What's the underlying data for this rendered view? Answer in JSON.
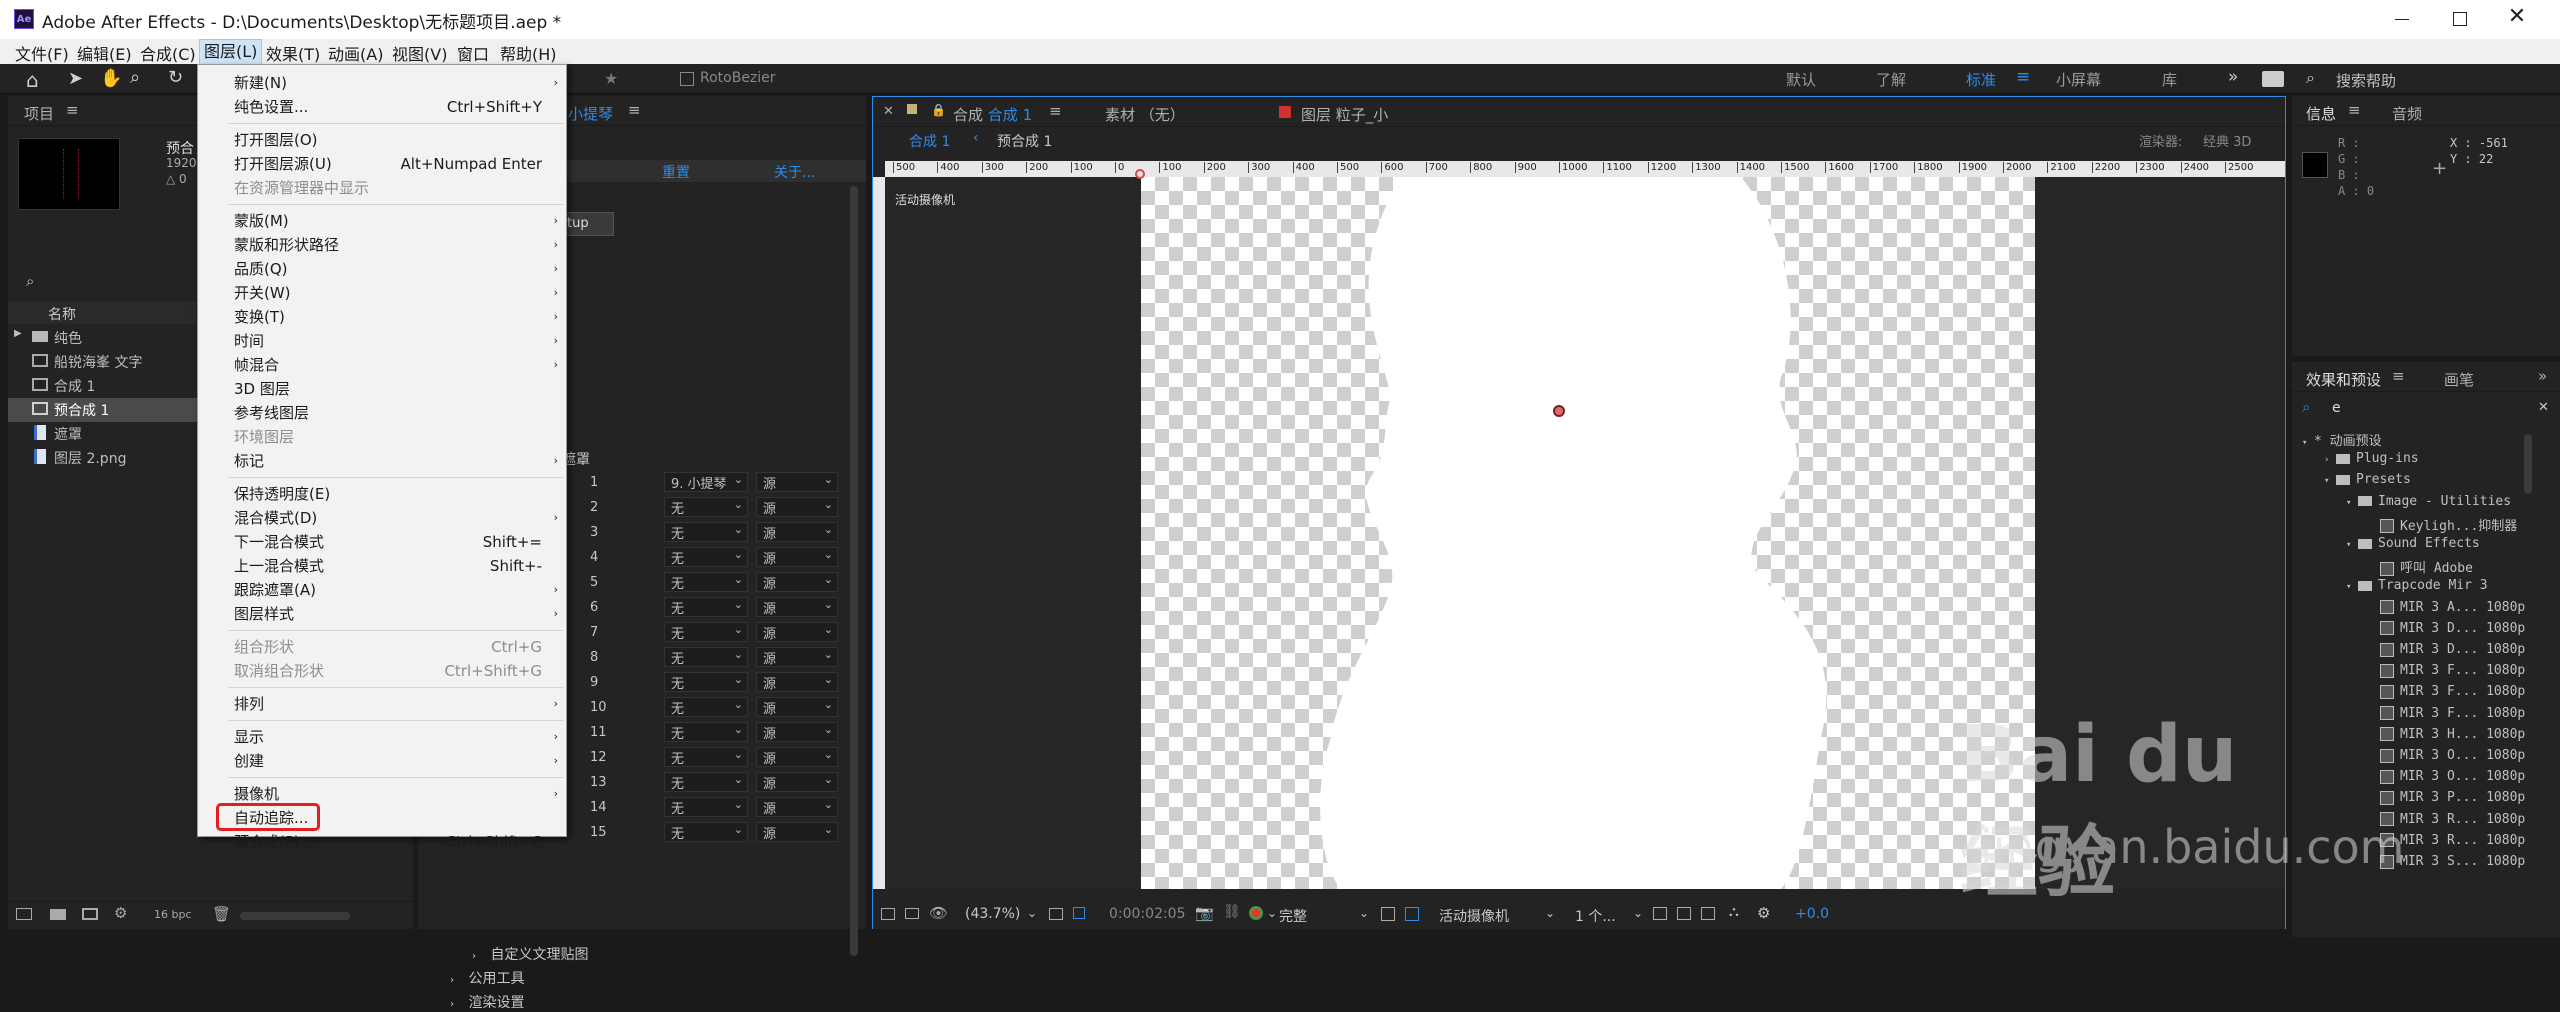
{
  "window": {
    "app_icon": "Ae",
    "title": "Adobe After Effects - D:\\Documents\\Desktop\\无标题项目.aep *",
    "controls": [
      "minimize-icon",
      "maximize-icon",
      "close-icon"
    ]
  },
  "menubar": [
    "文件(F)",
    "编辑(E)",
    "合成(C)",
    "图层(L)",
    "效果(T)",
    "动画(A)",
    "视图(V)",
    "窗口",
    "帮助(H)"
  ],
  "toolbar": {
    "rotobezier": "RotoBezier",
    "workspaces": [
      "默认",
      "了解",
      "标准",
      "小屏幕",
      "库"
    ],
    "active_workspace": "标准",
    "search_placeholder": "搜索帮助"
  },
  "project_panel": {
    "title": "项目",
    "preview_name": "预合",
    "preview_res": "1920",
    "preview_delta": "△ 0",
    "search_placeholder": "",
    "column_name": "名称",
    "items": [
      {
        "label": "纯色",
        "icon": "folder-icon"
      },
      {
        "label": "船锐海峯 文字",
        "icon": "composition-icon"
      },
      {
        "label": "合成 1",
        "icon": "composition-icon"
      },
      {
        "label": "预合成 1",
        "icon": "composition-icon",
        "selected": true
      },
      {
        "label": "遮罩",
        "icon": "file-icon"
      },
      {
        "label": "图层 2.png",
        "icon": "file-icon"
      }
    ],
    "bpc": "16 bpc"
  },
  "effects_controls": {
    "title_fragment": "小提琴",
    "reset": "重置",
    "about": "关于...",
    "up_button": "tup",
    "track_matte_header": "遮罩",
    "layer_rows": [
      {
        "num": "1",
        "matte": "9. 小提琴",
        "mode": "源"
      },
      {
        "num": "2",
        "matte": "无",
        "mode": "源"
      },
      {
        "num": "3",
        "matte": "无",
        "mode": "源"
      },
      {
        "num": "4",
        "matte": "无",
        "mode": "源"
      },
      {
        "num": "5",
        "matte": "无",
        "mode": "源"
      },
      {
        "num": "6",
        "matte": "无",
        "mode": "源"
      },
      {
        "num": "7",
        "matte": "无",
        "mode": "源"
      },
      {
        "num": "8",
        "matte": "无",
        "mode": "源"
      },
      {
        "num": "9",
        "matte": "无",
        "mode": "源"
      },
      {
        "num": "10",
        "matte": "无",
        "mode": "源"
      },
      {
        "num": "11",
        "matte": "无",
        "mode": "源"
      },
      {
        "num": "12",
        "matte": "无",
        "mode": "源"
      },
      {
        "num": "13",
        "matte": "无",
        "mode": "源"
      },
      {
        "num": "14",
        "matte": "无",
        "mode": "源"
      },
      {
        "num": "15",
        "matte": "无",
        "mode": "源"
      }
    ],
    "sections": [
      "自定义文理贴图",
      "公用工具",
      "渲染设置"
    ]
  },
  "layer_menu": {
    "items": [
      {
        "label": "新建(N)",
        "arrow": true
      },
      {
        "label": "纯色设置...",
        "shortcut": "Ctrl+Shift+Y"
      },
      {
        "sep": true
      },
      {
        "label": "打开图层(O)"
      },
      {
        "label": "打开图层源(U)",
        "shortcut": "Alt+Numpad Enter"
      },
      {
        "label": "在资源管理器中显示",
        "disabled": true
      },
      {
        "sep": true
      },
      {
        "label": "蒙版(M)",
        "arrow": true
      },
      {
        "label": "蒙版和形状路径",
        "arrow": true
      },
      {
        "label": "品质(Q)",
        "arrow": true
      },
      {
        "label": "开关(W)",
        "arrow": true
      },
      {
        "label": "变换(T)",
        "arrow": true
      },
      {
        "label": "时间",
        "arrow": true
      },
      {
        "label": "帧混合",
        "arrow": true
      },
      {
        "label": "3D 图层"
      },
      {
        "label": "参考线图层"
      },
      {
        "label": "环境图层",
        "disabled": true
      },
      {
        "label": "标记",
        "arrow": true
      },
      {
        "sep": true
      },
      {
        "label": "保持透明度(E)"
      },
      {
        "label": "混合模式(D)",
        "arrow": true
      },
      {
        "label": "下一混合模式",
        "shortcut": "Shift+="
      },
      {
        "label": "上一混合模式",
        "shortcut": "Shift+-"
      },
      {
        "label": "跟踪遮罩(A)",
        "arrow": true
      },
      {
        "label": "图层样式",
        "arrow": true
      },
      {
        "sep": true
      },
      {
        "label": "组合形状",
        "shortcut": "Ctrl+G",
        "disabled": true
      },
      {
        "label": "取消组合形状",
        "shortcut": "Ctrl+Shift+G",
        "disabled": true
      },
      {
        "sep": true
      },
      {
        "label": "排列",
        "arrow": true
      },
      {
        "sep": true
      },
      {
        "label": "显示",
        "arrow": true
      },
      {
        "label": "创建",
        "arrow": true
      },
      {
        "sep": true
      },
      {
        "label": "摄像机",
        "arrow": true
      },
      {
        "label": "自动追踪...",
        "highlighted": true
      },
      {
        "label": "预合成(P)...",
        "shortcut": "Ctrl+Shift+C"
      }
    ]
  },
  "comp_panel": {
    "tabs": [
      {
        "prefix": "合成",
        "name": "合成 1",
        "active": true
      },
      {
        "prefix": "素材",
        "name": "（无）"
      },
      {
        "prefix": "图层",
        "name": "粒子_小"
      }
    ],
    "breadcrumbs": [
      "合成 1",
      "预合成 1"
    ],
    "renderer_label": "渲染器:",
    "renderer_value": "经典 3D",
    "camera_label": "活动摄像机",
    "ruler_ticks": [
      "500",
      "400",
      "300",
      "200",
      "100",
      "0",
      "100",
      "200",
      "300",
      "400",
      "500",
      "600",
      "700",
      "800",
      "900",
      "1000",
      "1100",
      "1200",
      "1300",
      "1400",
      "1500",
      "1600",
      "1700",
      "1800",
      "1900",
      "2000",
      "2100",
      "2200",
      "2300",
      "2400",
      "2500"
    ],
    "bottom_bar": {
      "zoom": "(43.7%)",
      "timecode": "0:00:02:05",
      "resolution": "完整",
      "view": "活动摄像机",
      "views_count": "1 个...",
      "exposure": "+0.0"
    }
  },
  "info_panel": {
    "tabs": [
      "信息",
      "音频"
    ],
    "rgb": [
      "R :",
      "G :",
      "B :",
      "A : 0"
    ],
    "coords": [
      "X : -561",
      "Y : 22"
    ]
  },
  "effects_presets": {
    "tabs": [
      "效果和预设",
      "画笔"
    ],
    "search_value": "e",
    "tree": [
      {
        "label": "* 动画预设",
        "depth": 0,
        "open": true
      },
      {
        "label": "Plug-ins",
        "depth": 1,
        "folder": true
      },
      {
        "label": "Presets",
        "depth": 1,
        "folder": true,
        "open": true
      },
      {
        "label": "Image - Utilities",
        "depth": 2,
        "folder": true,
        "open": true
      },
      {
        "label": "Keyligh...抑制器",
        "depth": 3
      },
      {
        "label": "Sound Effects",
        "depth": 2,
        "folder": true,
        "open": true
      },
      {
        "label": "呼叫 Adobe",
        "depth": 3
      },
      {
        "label": "Trapcode Mir 3",
        "depth": 2,
        "folder": true,
        "open": true
      },
      {
        "label": "MIR 3 A... 1080p",
        "depth": 3
      },
      {
        "label": "MIR 3 D... 1080p",
        "depth": 3
      },
      {
        "label": "MIR 3 D... 1080p",
        "depth": 3
      },
      {
        "label": "MIR 3 F... 1080p",
        "depth": 3
      },
      {
        "label": "MIR 3 F... 1080p",
        "depth": 3
      },
      {
        "label": "MIR 3 F... 1080p",
        "depth": 3
      },
      {
        "label": "MIR 3 H... 1080p",
        "depth": 3
      },
      {
        "label": "MIR 3 O... 1080p",
        "depth": 3
      },
      {
        "label": "MIR 3 O... 1080p",
        "depth": 3
      },
      {
        "label": "MIR 3 P... 1080p",
        "depth": 3
      },
      {
        "label": "MIR 3 R... 1080p",
        "depth": 3
      },
      {
        "label": "MIR 3 R... 1080p",
        "depth": 3
      },
      {
        "label": "MIR 3 S... 1080p",
        "depth": 3
      }
    ]
  },
  "watermark": {
    "text": "Bai du 经验",
    "url": "jingyan.baidu.com"
  },
  "colors": {
    "accent": "#2d8ceb",
    "menu_highlight_box": "#e02020",
    "panel_bg": "#232323"
  }
}
